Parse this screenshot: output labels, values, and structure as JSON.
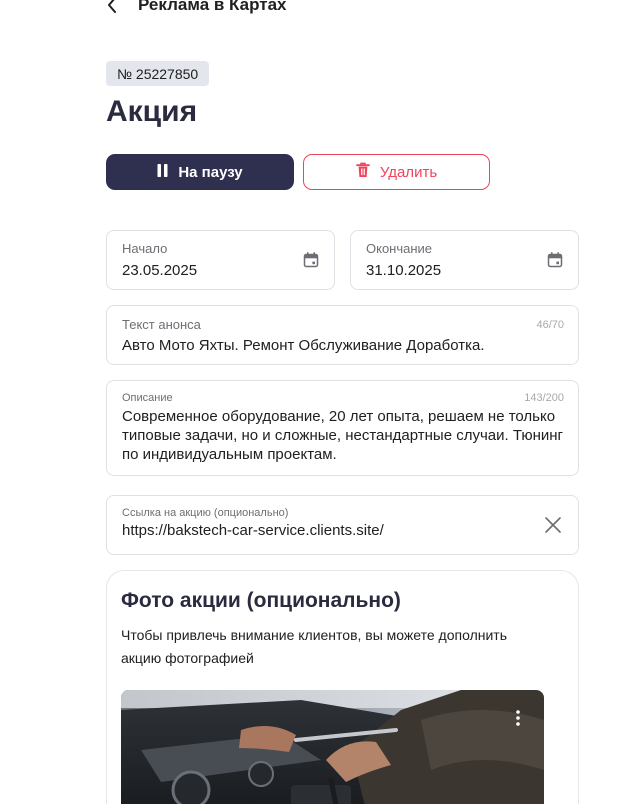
{
  "header": {
    "back_icon": "chevron-left-icon",
    "title": "Реклама в Картах"
  },
  "promo": {
    "number": "№ 25227850",
    "title": "Акция",
    "pause_label": "На паузу",
    "pause_icon": "pause-icon",
    "delete_label": "Удалить",
    "delete_icon": "trash-icon"
  },
  "dates": {
    "start_label": "Начало",
    "start_value": "23.05.2025",
    "end_label": "Окончание",
    "end_value": "31.10.2025",
    "icon": "calendar-icon"
  },
  "announcement": {
    "label": "Текст анонса",
    "value": "Авто Мото Яхты. Ремонт Обслуживание Доработка.",
    "counter": "46/70"
  },
  "description": {
    "label": "Описание",
    "value": "Современное оборудование, 20 лет опыта, решаем не только типовые задачи, но и сложные, нестандартные случаи. Тюнинг по индивидуальным проектам.",
    "counter": "143/200"
  },
  "link": {
    "label": "Ссылка на акцию (опционально)",
    "value": "https://bakstech-car-service.clients.site/",
    "clear_icon": "close-icon"
  },
  "photo": {
    "title": "Фото акции (опционально)",
    "description": "Чтобы привлечь внимание клиентов, вы можете дополнить акцию фотографией",
    "menu_icon": "more-vertical-icon"
  },
  "colors": {
    "primary": "#2f2f4f",
    "danger": "#f0435c",
    "badge_bg": "#e3e6ec",
    "border": "#dfe1e6"
  }
}
